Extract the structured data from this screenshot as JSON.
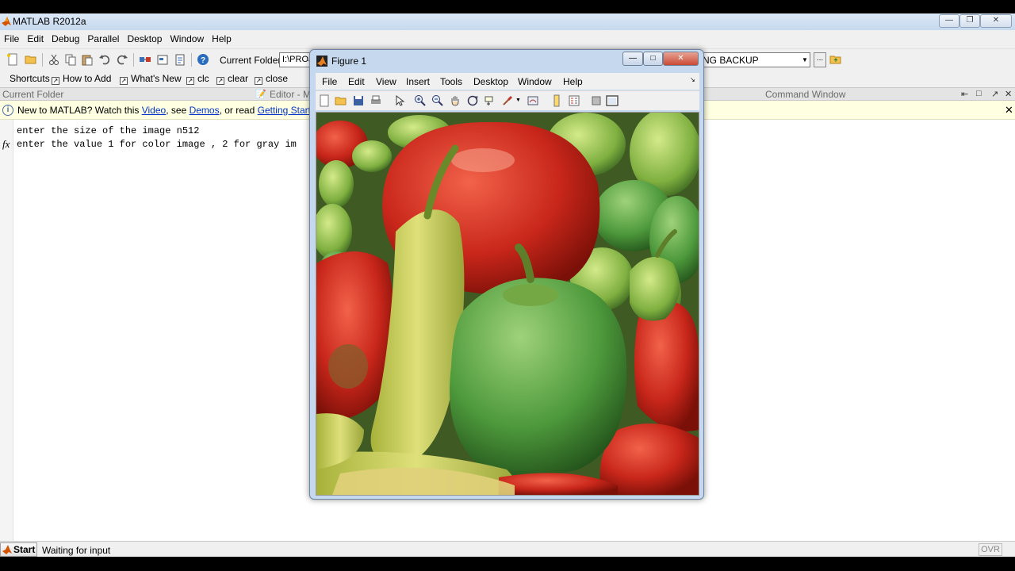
{
  "app": {
    "title": "MATLAB  R2012a",
    "window_controls": [
      "—",
      "❐",
      "✕"
    ]
  },
  "menu": [
    "File",
    "Edit",
    "Debug",
    "Parallel",
    "Desktop",
    "Window",
    "Help"
  ],
  "toolbar": {
    "current_folder_label": "Current Folder:",
    "current_folder_value": "I:\\PROJ",
    "current_folder_tail": "NG BACKUP",
    "browse_label": "..."
  },
  "shortcuts": [
    "Shortcuts",
    "How to Add",
    "What's New",
    "clc",
    "clear",
    "close"
  ],
  "panels": {
    "current_folder": "Current Folder",
    "editor": "Editor - M",
    "command_window": "Command Window"
  },
  "infobar": {
    "prefix": "New to MATLAB? Watch this ",
    "video_link": "Video",
    "middle1": ", see ",
    "demos_link": "Demos",
    "middle2": ", or read ",
    "getting_started_link": "Getting Started",
    "suffix": "."
  },
  "command_window": {
    "lines": [
      "enter the size of the image n512",
      "enter the value 1 for color image , 2 for gray im"
    ],
    "prompt_symbol": "fx"
  },
  "status": {
    "start_label": "Start",
    "text": "Waiting for input",
    "ovr": "OVR"
  },
  "figure": {
    "title": "Figure 1",
    "menu": [
      "File",
      "Edit",
      "View",
      "Insert",
      "Tools",
      "Desktop",
      "Window",
      "Help"
    ]
  },
  "colors": {
    "title_bar": "#c7d9ee",
    "info_bar": "#ffffe1",
    "link": "#0033cc",
    "figure_frame": "#c6d8ee"
  }
}
